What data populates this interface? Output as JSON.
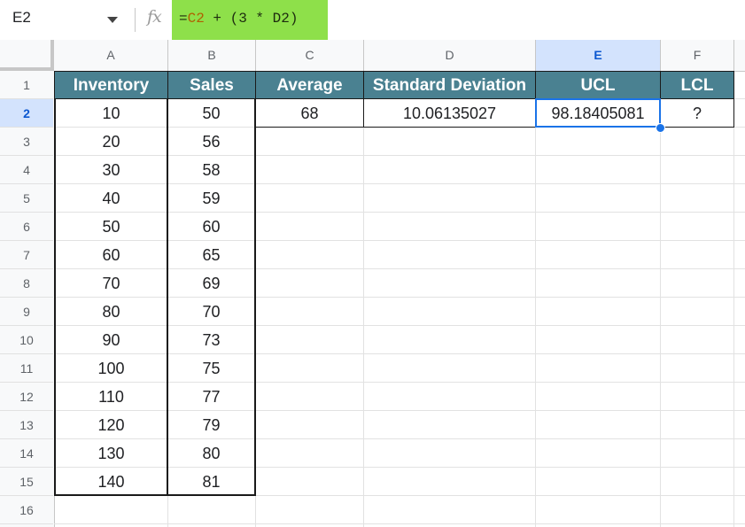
{
  "formula_bar": {
    "cell_ref": "E2",
    "fx": "fx",
    "formula_prefix": "=",
    "formula_ref1": "C2",
    "formula_mid": " + (3 * ",
    "formula_ref2": "D2",
    "formula_suffix": ")"
  },
  "columns": [
    "A",
    "B",
    "C",
    "D",
    "E",
    "F"
  ],
  "selected_column": "E",
  "rows": [
    "1",
    "2",
    "3",
    "4",
    "5",
    "6",
    "7",
    "8",
    "9",
    "10",
    "11",
    "12",
    "13",
    "14",
    "15",
    "16"
  ],
  "selected_row": "2",
  "headers": {
    "A": "Inventory",
    "B": "Sales",
    "C": "Average",
    "D": "Standard Deviation",
    "E": "UCL",
    "F": "LCL"
  },
  "row2": {
    "C": "68",
    "D": "10.06135027",
    "E": "98.18405081",
    "F": "?"
  },
  "table": [
    {
      "inventory": "10",
      "sales": "50"
    },
    {
      "inventory": "20",
      "sales": "56"
    },
    {
      "inventory": "30",
      "sales": "58"
    },
    {
      "inventory": "40",
      "sales": "59"
    },
    {
      "inventory": "50",
      "sales": "60"
    },
    {
      "inventory": "60",
      "sales": "65"
    },
    {
      "inventory": "70",
      "sales": "69"
    },
    {
      "inventory": "80",
      "sales": "70"
    },
    {
      "inventory": "90",
      "sales": "73"
    },
    {
      "inventory": "100",
      "sales": "75"
    },
    {
      "inventory": "110",
      "sales": "77"
    },
    {
      "inventory": "120",
      "sales": "79"
    },
    {
      "inventory": "130",
      "sales": "80"
    },
    {
      "inventory": "140",
      "sales": "81"
    }
  ],
  "colors": {
    "header_fill": "#4a8191",
    "formula_highlight": "#8ee04a",
    "selection": "#1a73e8"
  }
}
